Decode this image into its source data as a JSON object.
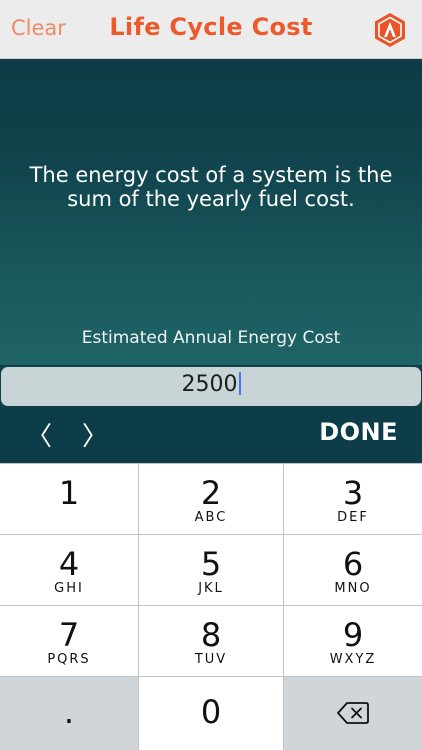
{
  "header": {
    "clear_label": "Clear",
    "title": "Life Cycle Cost",
    "logo_icon": "app-logo-icon",
    "accent_color": "#ec5a2c"
  },
  "content": {
    "message": "The energy cost of a system is the sum of the yearly fuel cost.",
    "field_label": "Estimated Annual Energy Cost"
  },
  "input": {
    "value": "2500"
  },
  "toolbar": {
    "prev_icon": "chevron-left-icon",
    "next_icon": "chevron-right-icon",
    "prev_glyph": "〈",
    "next_glyph": "〉",
    "done_label": "DONE"
  },
  "keypad": {
    "keys": [
      {
        "digit": "1",
        "letters": ""
      },
      {
        "digit": "2",
        "letters": "ABC"
      },
      {
        "digit": "3",
        "letters": "DEF"
      },
      {
        "digit": "4",
        "letters": "GHI"
      },
      {
        "digit": "5",
        "letters": "JKL"
      },
      {
        "digit": "6",
        "letters": "MNO"
      },
      {
        "digit": "7",
        "letters": "PQRS"
      },
      {
        "digit": "8",
        "letters": "TUV"
      },
      {
        "digit": "9",
        "letters": "WXYZ"
      },
      {
        "digit": ".",
        "letters": ""
      },
      {
        "digit": "0",
        "letters": ""
      }
    ],
    "delete_icon": "backspace-icon"
  }
}
